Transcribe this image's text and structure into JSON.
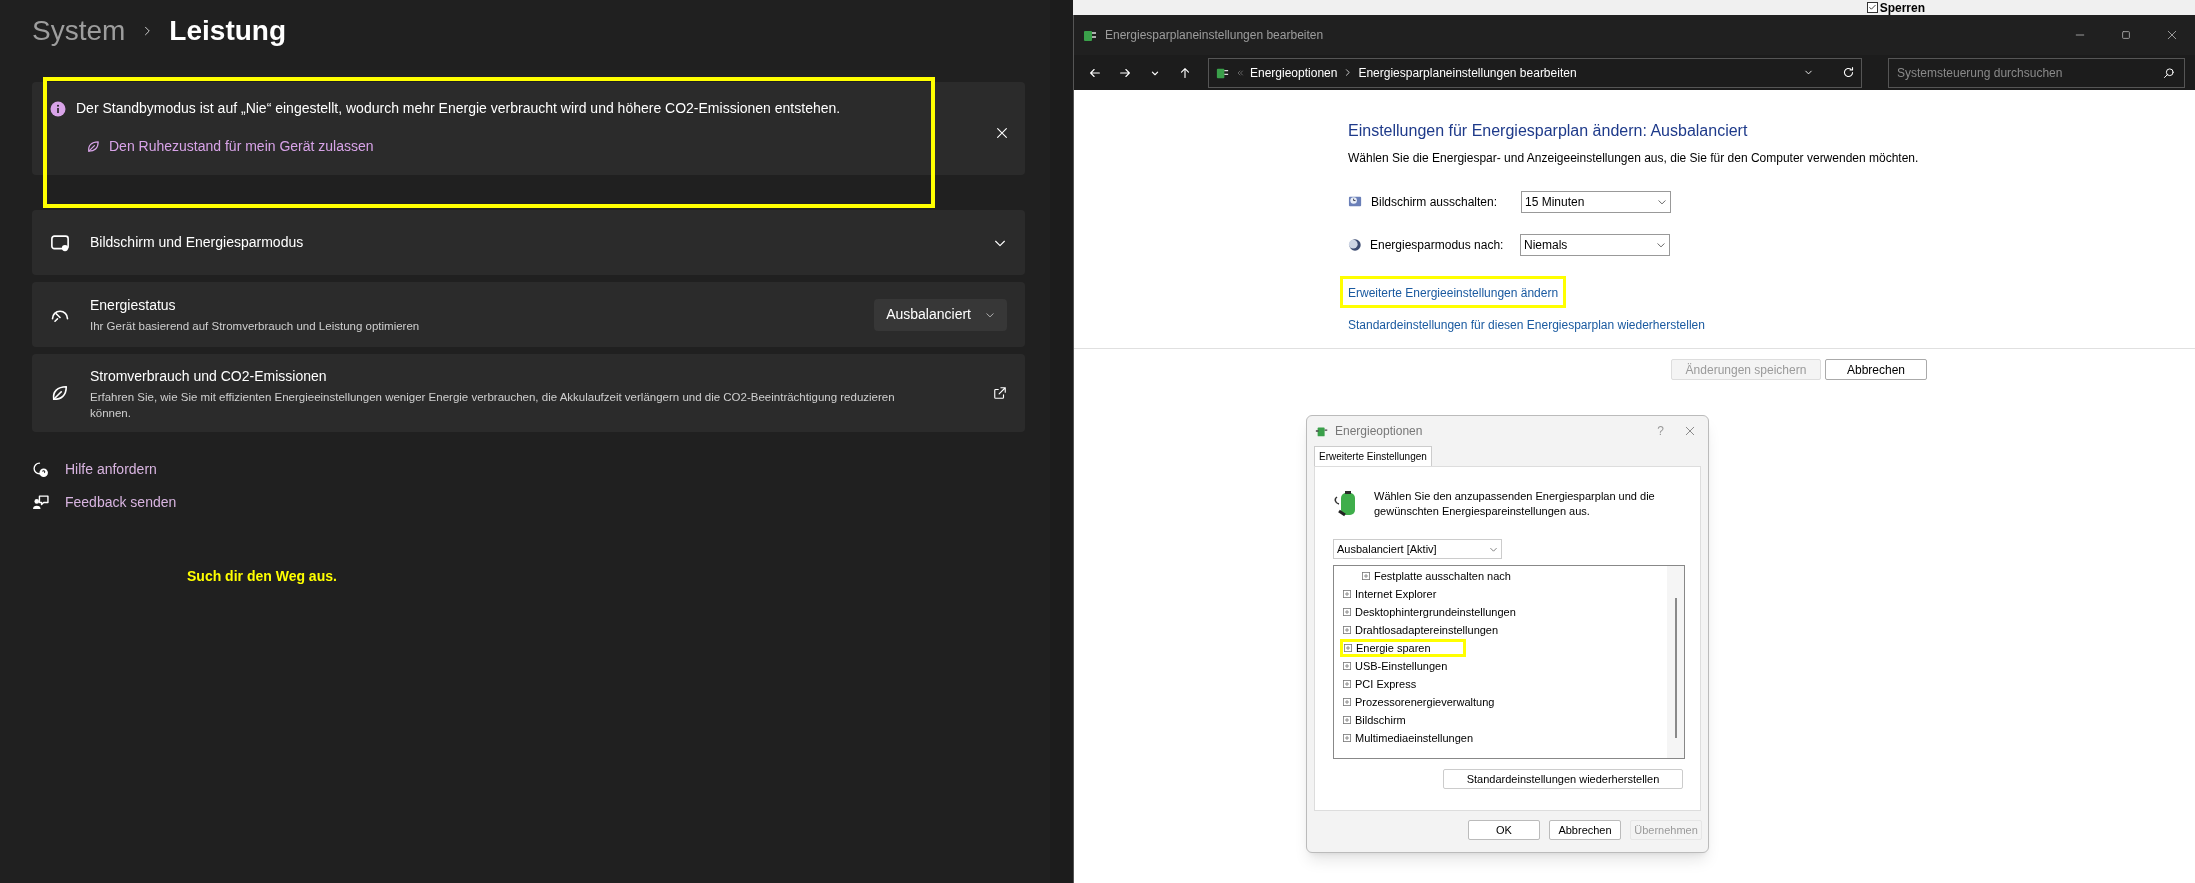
{
  "settings": {
    "breadcrumb": [
      "System",
      "Leistung"
    ],
    "notice": {
      "message": "Der Standbymodus ist auf „Nie“ eingestellt, wodurch mehr Energie verbraucht wird und höhere CO2-Emissionen entstehen.",
      "link": "Den Ruhezustand für mein Gerät zulassen",
      "highlighted": true
    },
    "cards": [
      {
        "kind": "expander",
        "title": "Bildschirm und Energiesparmodus"
      },
      {
        "kind": "dropdown",
        "title": "Energiestatus",
        "subtitle": "Ihr Gerät basierend auf Stromverbrauch und Leistung optimieren",
        "value": "Ausbalanciert"
      },
      {
        "kind": "external",
        "title": "Stromverbrauch und CO2-Emissionen",
        "subtitle": "Erfahren Sie, wie Sie mit effizienten Energieeinstellungen weniger Energie verbrauchen, die Akkulaufzeit verlängern und die CO2-Beeinträchtigung reduzieren können."
      }
    ],
    "links": [
      {
        "label": "Hilfe anfordern"
      },
      {
        "label": "Feedback senden"
      }
    ],
    "annotation": "Such dir den Weg aus."
  },
  "background_window": {
    "checkbox": {
      "label": "Sperren",
      "checked": true
    }
  },
  "control_panel": {
    "window_title": "Energiesparplaneinstellungen bearbeiten",
    "breadcrumb": [
      "Energieoptionen",
      "Energiesparplaneinstellungen bearbeiten"
    ],
    "search": {
      "placeholder": "Systemsteuerung durchsuchen"
    },
    "heading": "Einstellungen für Energiesparplan ändern: Ausbalanciert",
    "description": "Wählen Sie die Energiespar- und Anzeigeeinstellungen aus, die Sie für den Computer verwenden möchten.",
    "settings": [
      {
        "label": "Bildschirm ausschalten:",
        "value": "15 Minuten"
      },
      {
        "label": "Energiesparmodus nach:",
        "value": "Niemals"
      }
    ],
    "links": [
      {
        "label": "Erweiterte Energieeinstellungen ändern",
        "highlighted": true
      },
      {
        "label": "Standardeinstellungen für diesen Energiesparplan wiederherstellen",
        "highlighted": false
      }
    ],
    "buttons": [
      {
        "label": "Änderungen speichern",
        "disabled": true
      },
      {
        "label": "Abbrechen",
        "disabled": false
      }
    ]
  },
  "dialog": {
    "title": "Energieoptionen",
    "help": "?",
    "tabs": [
      {
        "label": "Erweiterte Einstellungen",
        "selected": true
      }
    ],
    "intro": "Wählen Sie den anzupassenden Energiesparplan und die gewünschten Energiespareinstellungen aus.",
    "plan": "Ausbalanciert [Aktiv]",
    "tree": [
      {
        "children": [
          {
            "label": "Festplatte ausschalten nach",
            "highlighted": false
          }
        ]
      },
      {
        "label": "Internet Explorer",
        "highlighted": false
      },
      {
        "label": "Desktophintergrundeinstellungen",
        "highlighted": false
      },
      {
        "label": "Drahtlosadaptereinstellungen",
        "highlighted": false
      },
      {
        "label": "Energie sparen",
        "highlighted": true
      },
      {
        "label": "USB-Einstellungen",
        "highlighted": false
      },
      {
        "label": "PCI Express",
        "highlighted": false
      },
      {
        "label": "Prozessorenergieverwaltung",
        "highlighted": false
      },
      {
        "label": "Bildschirm",
        "highlighted": false
      },
      {
        "label": "Multimediaeinstellungen",
        "highlighted": false
      }
    ],
    "restore_button": "Standardeinstellungen wiederherstellen",
    "buttons": [
      {
        "label": "OK",
        "disabled": false
      },
      {
        "label": "Abbrechen",
        "disabled": false
      },
      {
        "label": "Übernehmen",
        "disabled": true
      }
    ]
  }
}
